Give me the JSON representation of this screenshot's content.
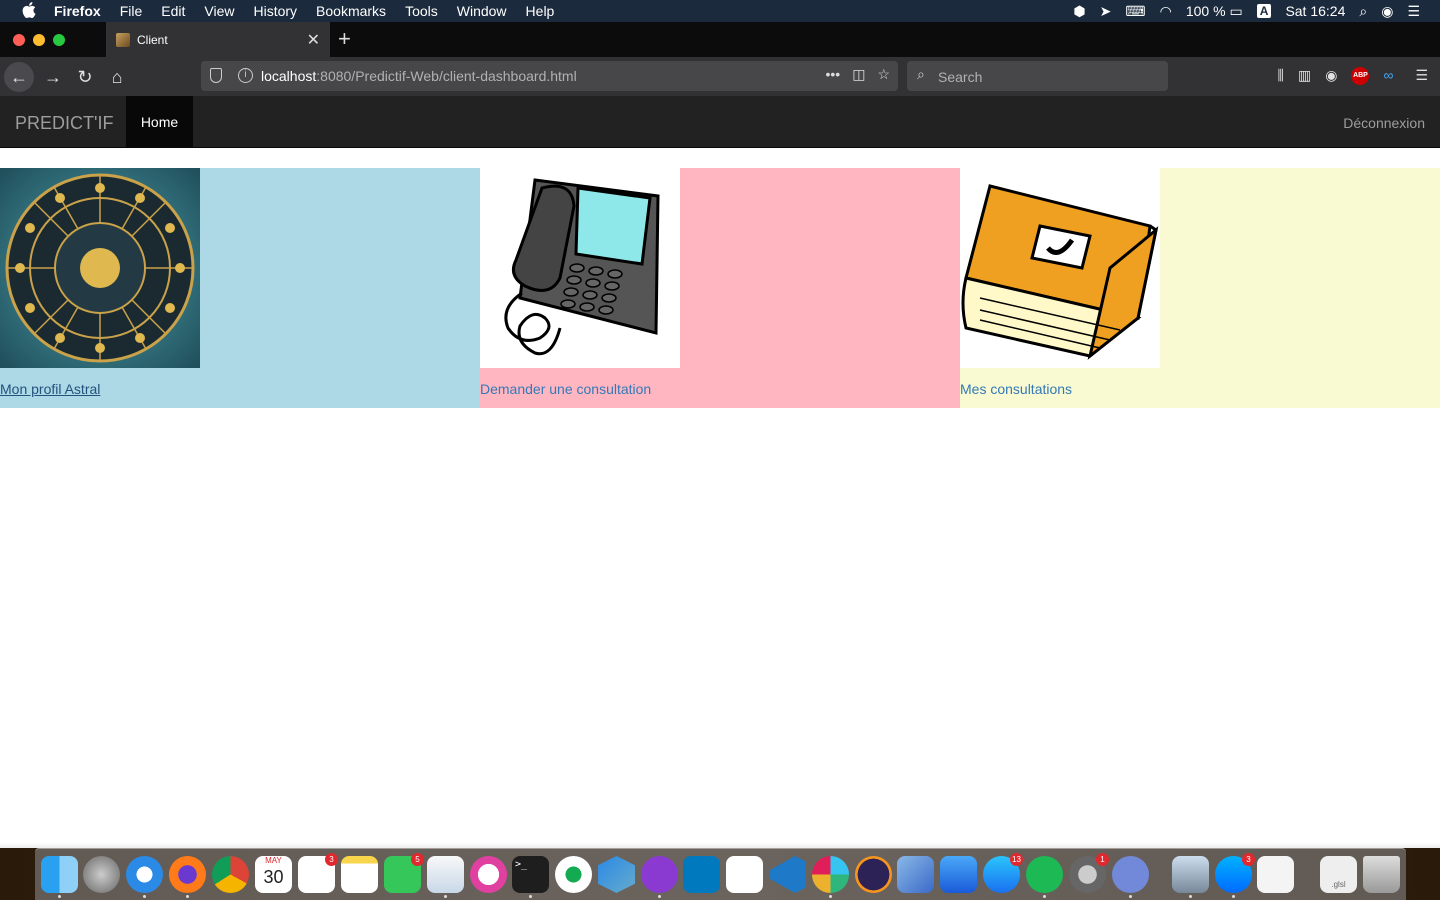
{
  "menubar": {
    "app": "Firefox",
    "items": [
      "File",
      "Edit",
      "View",
      "History",
      "Bookmarks",
      "Tools",
      "Window",
      "Help"
    ],
    "battery": "100 %",
    "input_source": "A",
    "clock": "Sat 16:24"
  },
  "browser": {
    "tab_title": "Client",
    "url_host": "localhost",
    "url_path": ":8080/Predictif-Web/client-dashboard.html",
    "search_placeholder": "Search",
    "abp_label": "ABP"
  },
  "site": {
    "brand": "PREDICT'IF",
    "home": "Home",
    "logout": "Déconnexion"
  },
  "tiles": [
    {
      "label": "Mon profil Astral",
      "color": "#add8e6",
      "image": "zodiac-wheel-image"
    },
    {
      "label": "Demander une consultation",
      "color": "#ffb6c1",
      "image": "telephone-image"
    },
    {
      "label": "Mes consultations",
      "color": "#fafad2",
      "image": "book-image"
    }
  ],
  "dock": {
    "calendar_month": "MAY",
    "calendar_day": "30",
    "badges": {
      "reminders": "3",
      "facetime": "5",
      "appstore": "13",
      "settings": "1",
      "messenger": "3"
    },
    "glsl_file": ".glsl"
  }
}
